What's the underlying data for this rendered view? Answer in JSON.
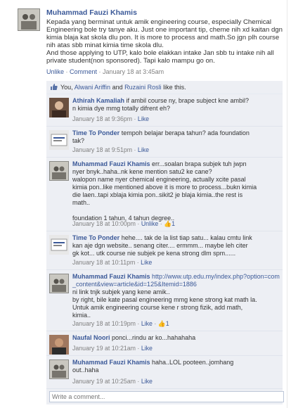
{
  "post": {
    "author": "Muhammad Fauzi Khamis",
    "body": "Kepada yang berminat untuk amik engineering course, especially Chemical Engineering bole try tanye aku. Just one important tip, cheme nih xd kaitan dgn kimia blaja kat skola dlu pon. It is more to process and math.So jgn plh course nih atas sbb minat kimia time skola dlu.\nAnd those applying to UTP, kalo bole elakkan intake Jan sbb tu intake nih all private student(non sponsored). Tapi kalo mampu go on.",
    "actions": {
      "unlike": "Unlike",
      "sep": " · ",
      "comment": "Comment",
      "timestamp": " · January 18 at 3:45am"
    }
  },
  "likes": {
    "prefix": "You, ",
    "person1": "Alwani Ariffin",
    "and": " and ",
    "person2": "Ruzaini Rosli",
    "suffix": " like this."
  },
  "comments": [
    {
      "name": "Athirah Kamaliah",
      "text": " if ambil course ny, brape subject kne ambil?\nn kimia dye mmg totally difrent eh?",
      "time": "January 18 at 9:36pm",
      "like": "Like",
      "count": ""
    },
    {
      "name": "Time To Ponder",
      "text": " tempoh belajar berapa tahun? ada foundation\ntak?",
      "time": "January 18 at 9:51pm",
      "like": "Like",
      "count": ""
    },
    {
      "name": "Muhammad Fauzi Khamis",
      "text": " err...soalan brapa subjek tuh jwpn\nnyer bnyk..haha..nk kene mention satu2 ke cane?\nwalopon name nyer chemical engineering, actually xcite pasal\nkimia pon..like mentioned above it is more to process...bukn kimia\ndie laen..tapi xblaja kimia pon..sikit2 je blaja kimia..the rest is\nmath..\n\nfoundation 1 tahun, 4 tahun degree..",
      "time": "January 18 at 10:00pm",
      "like": "Unlike",
      "count": "1"
    },
    {
      "name": "Time To Ponder",
      "text": " hehe.... tak de la list tiap satu... kalau cmtu link\nkan aje dgn website.. senang citer.... ermmm... maybe leh citer\ngk kot... utk course nie subjek pe kena strong dlm spm......",
      "time": "January 18 at 10:11pm",
      "like": "Like",
      "count": ""
    },
    {
      "name": "Muhammad Fauzi Khamis",
      "link": "http://www.utp.edu.my/index.php?option=com_content&view=article&id=125&Itemid=1886",
      "text": "\nni link tnjk subjek yang kene amik..\nby right, bile kate pasal engineering mmg kene strong kat math la.\nUntuk amik engineering course kene r strong fizik, add math,\nkimia..",
      "time": "January 18 at 10:19pm",
      "like": "Like",
      "count": "1"
    },
    {
      "name": "Naufal Noori",
      "text": " ponci...rindu ar ko...hahahaha",
      "time": "January 19 at 10:21am",
      "like": "Like",
      "count": ""
    },
    {
      "name": "Muhammad Fauzi Khamis",
      "text": " haha..LOL pooteen..jomhang\nout..haha",
      "time": "January 19 at 10:25am",
      "like": "Like",
      "count": ""
    }
  ],
  "write_comment_placeholder": "Write a comment...",
  "icons": {
    "like": "thumbs-up-icon"
  },
  "colors": {
    "link": "#3b5998",
    "comment_bg": "#edeff4",
    "meta": "#808080"
  }
}
